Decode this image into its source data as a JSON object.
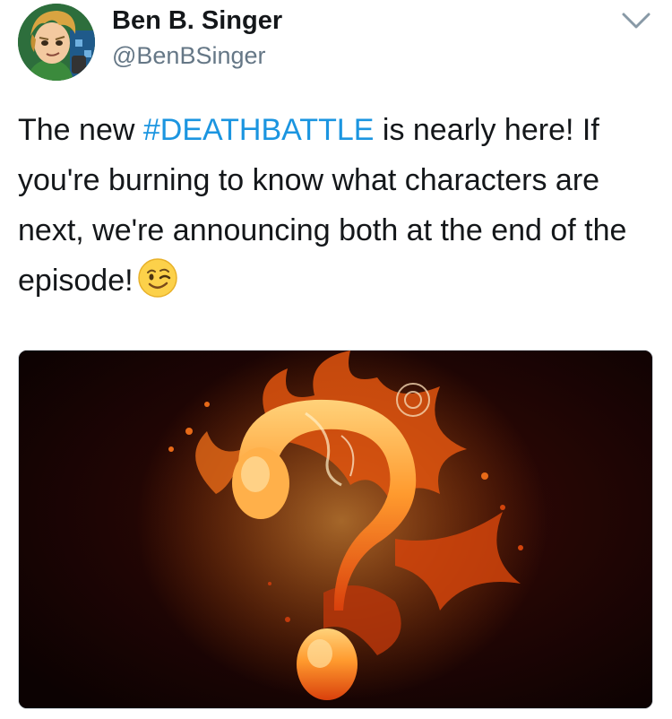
{
  "tweet": {
    "author": {
      "display_name": "Ben B. Singer",
      "handle": "@BenBSinger"
    },
    "text_before": "The new ",
    "hashtag": "#DEATHBATTLE",
    "text_after": " is nearly here! If you're burning to know what characters are next, we're announcing both at the end of the episode!",
    "emoji": "winking-face",
    "media": {
      "description_icon": "flaming-question-mark"
    }
  },
  "colors": {
    "hashtag": "#1b95e0",
    "handle": "#657786",
    "text": "#14171a",
    "caret": "#8899a6"
  }
}
